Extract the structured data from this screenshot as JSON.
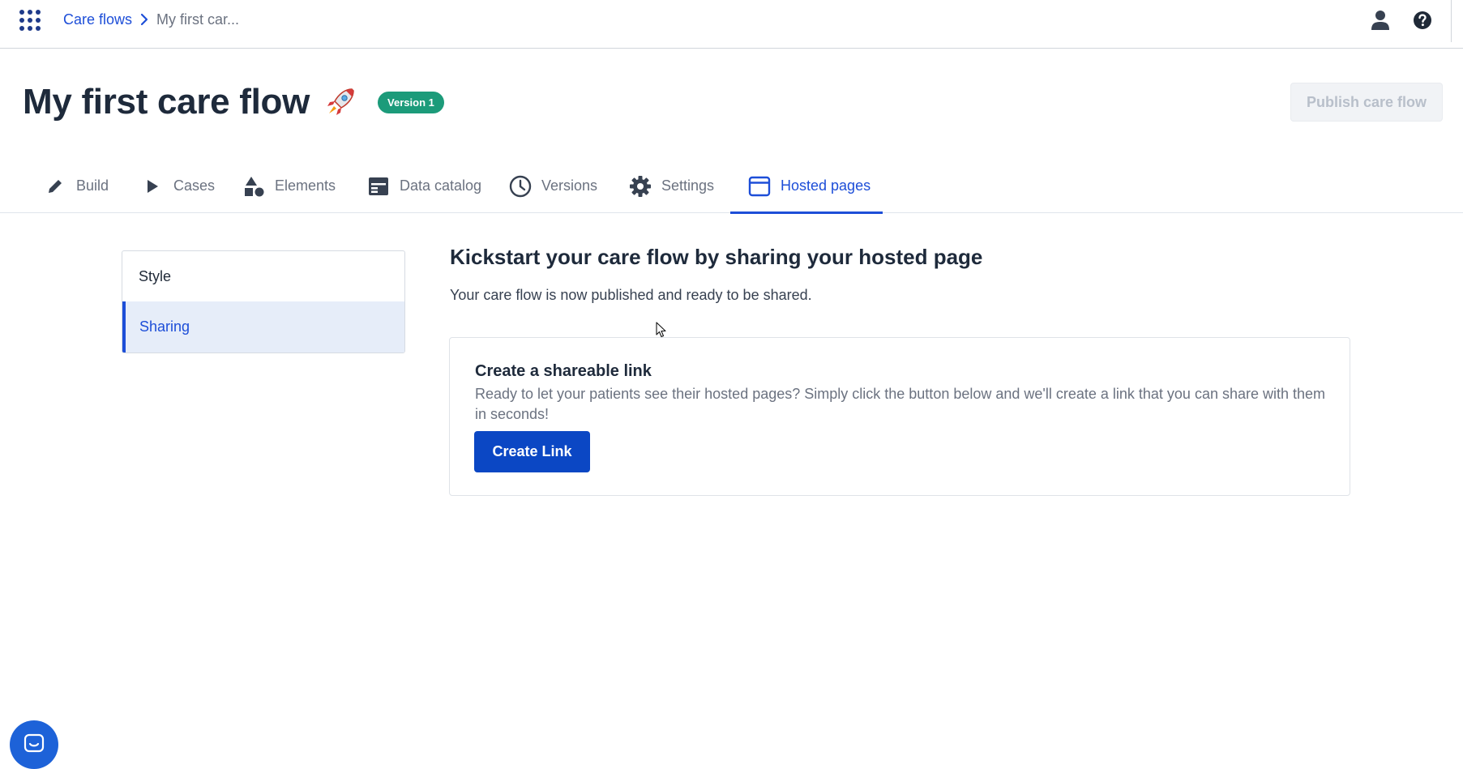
{
  "breadcrumb": {
    "root": "Care flows",
    "current": "My first car..."
  },
  "header": {
    "title": "My first care flow",
    "version_badge": "Version 1",
    "publish_label": "Publish care flow"
  },
  "tabs": [
    {
      "label": "Build",
      "icon": "pencil-icon"
    },
    {
      "label": "Cases",
      "icon": "play-icon"
    },
    {
      "label": "Elements",
      "icon": "shapes-icon"
    },
    {
      "label": "Data catalog",
      "icon": "catalog-icon"
    },
    {
      "label": "Versions",
      "icon": "clock-icon"
    },
    {
      "label": "Settings",
      "icon": "gear-icon"
    },
    {
      "label": "Hosted pages",
      "icon": "browser-window-icon",
      "active": true
    }
  ],
  "side_menu": {
    "items": [
      {
        "label": "Style"
      },
      {
        "label": "Sharing",
        "active": true
      }
    ]
  },
  "main": {
    "heading": "Kickstart your care flow by sharing your hosted page",
    "subheading": "Your care flow is now published and ready to be shared.",
    "card": {
      "title": "Create a shareable link",
      "description": "Ready to let your patients see their hosted pages? Simply click the button below and we'll create a link that you can share with them in seconds!",
      "button_label": "Create Link"
    }
  },
  "colors": {
    "accent": "#1d4ed8",
    "primary_button": "#0b47c4",
    "version_badge": "#1c9b7a",
    "active_tab_bg": "#e6edf9"
  }
}
